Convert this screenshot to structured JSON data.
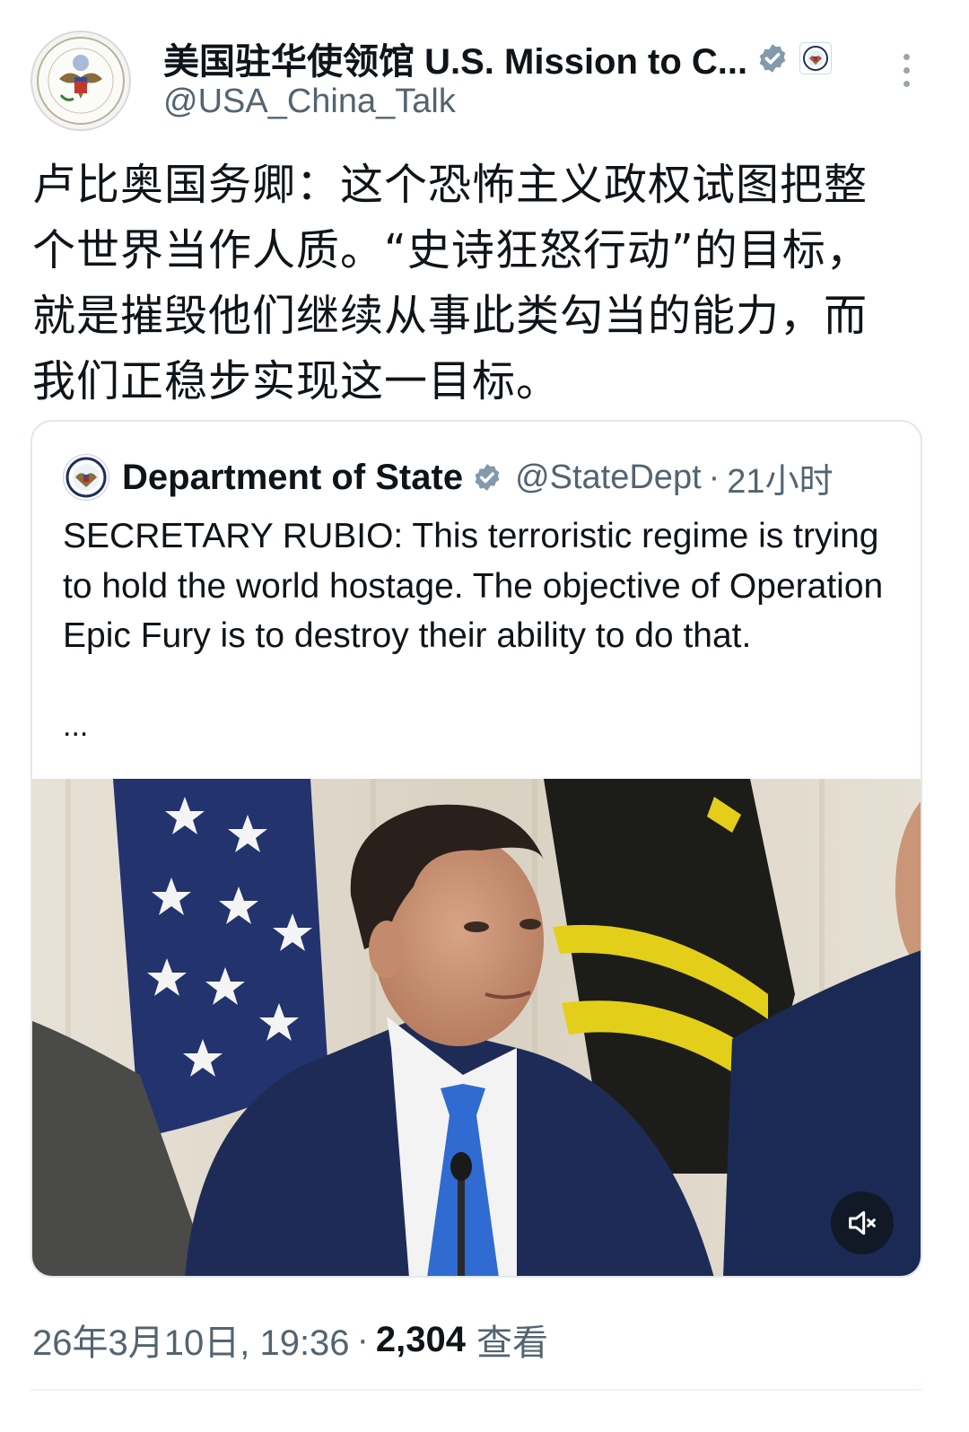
{
  "author": {
    "display_name": "美国驻华使领馆 U.S. Mission to C...",
    "handle": "@USA_China_Talk"
  },
  "tweet": {
    "lines": [
      "卢比奥国务卿：这个恐怖主义政权试图把整",
      "个世界当作人质。“史诗狂怒行动”的目标，",
      "就是摧毁他们继续从事此类勾当的能力，而",
      "我们正稳步实现这一目标。"
    ]
  },
  "quoted": {
    "display_name": "Department of State",
    "handle": "@StateDept",
    "separator": "·",
    "time": "21小时",
    "text": "SECRETARY RUBIO: This terroristic regime is trying to hold the world hostage. The objective of Operation Epic Fury is to destroy their ability to do that.",
    "ellipsis": "...",
    "media": {
      "kind": "video",
      "muted": true
    }
  },
  "meta": {
    "datetime": "26年3月10日, 19:36",
    "separator": "·",
    "views_count": "2,304",
    "views_label": "查看"
  },
  "icons": {
    "verified": "verified-badge-icon",
    "affiliation": "state-seal-icon",
    "more": "more-vertical-icon",
    "mute": "volume-muted-icon"
  },
  "colors": {
    "verified_badge": "#829aab",
    "secondary_text": "#536471",
    "primary_text": "#0f1419"
  }
}
